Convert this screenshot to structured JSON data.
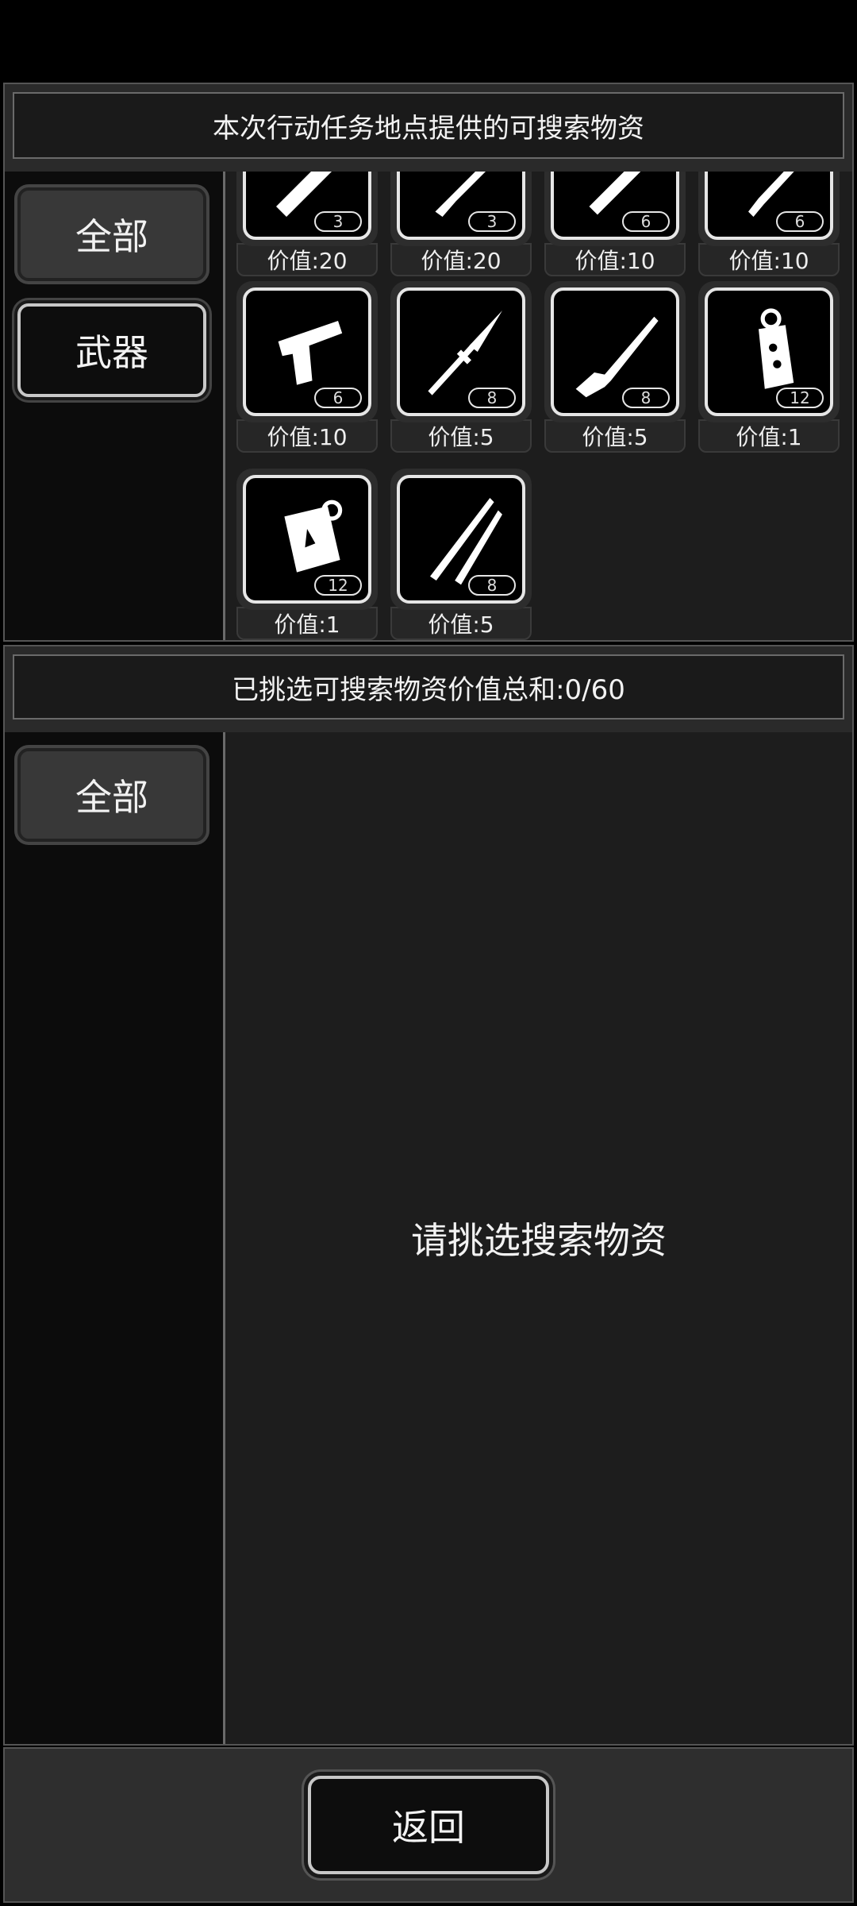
{
  "top_panel": {
    "title": "本次行动任务地点提供的可搜索物资",
    "categories": [
      {
        "label": "全部"
      },
      {
        "label": "武器"
      }
    ],
    "items": [
      {
        "icon": "flashlight-icon",
        "count": "3",
        "value": "价值:20"
      },
      {
        "icon": "knife-icon",
        "count": "3",
        "value": "价值:20"
      },
      {
        "icon": "baton-icon",
        "count": "6",
        "value": "价值:10"
      },
      {
        "icon": "dagger-icon",
        "count": "6",
        "value": "价值:10"
      },
      {
        "icon": "pistol-icon",
        "count": "6",
        "value": "价值:10"
      },
      {
        "icon": "spear-icon",
        "count": "8",
        "value": "价值:5"
      },
      {
        "icon": "shotgun-icon",
        "count": "8",
        "value": "价值:5"
      },
      {
        "icon": "grenade-icon",
        "count": "12",
        "value": "价值:1"
      },
      {
        "icon": "incendiary-bomb-icon",
        "count": "12",
        "value": "价值:1"
      },
      {
        "icon": "katana-icon",
        "count": "8",
        "value": "价值:5"
      }
    ]
  },
  "bottom_panel": {
    "title": "已挑选可搜索物资价值总和:0/60",
    "categories": [
      {
        "label": "全部"
      }
    ],
    "empty_message": "请挑选搜索物资"
  },
  "footer": {
    "back_label": "返回"
  }
}
